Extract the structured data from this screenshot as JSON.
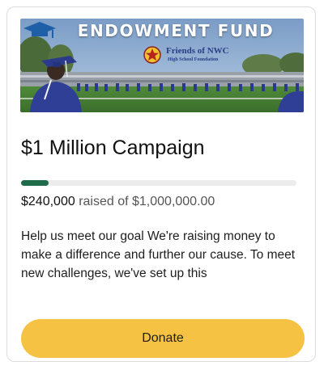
{
  "banner": {
    "title": "ENDOWMENT FUND",
    "org_name": "Friends of NWC",
    "org_subtitle": "High School Foundation"
  },
  "campaign": {
    "title": "$1 Million Campaign",
    "progress_fraction": 0.1,
    "raised_amount": "$240,000",
    "raised_suffix": "raised of $1,000,000.00",
    "description": "Help us meet our goal We're raising money to make a difference and further our cause. To meet new challenges, we've set up this",
    "donate_label": "Donate"
  },
  "colors": {
    "progress_fill": "#1f6b4a",
    "progress_track": "#ececec",
    "donate_button": "#f6c244"
  }
}
